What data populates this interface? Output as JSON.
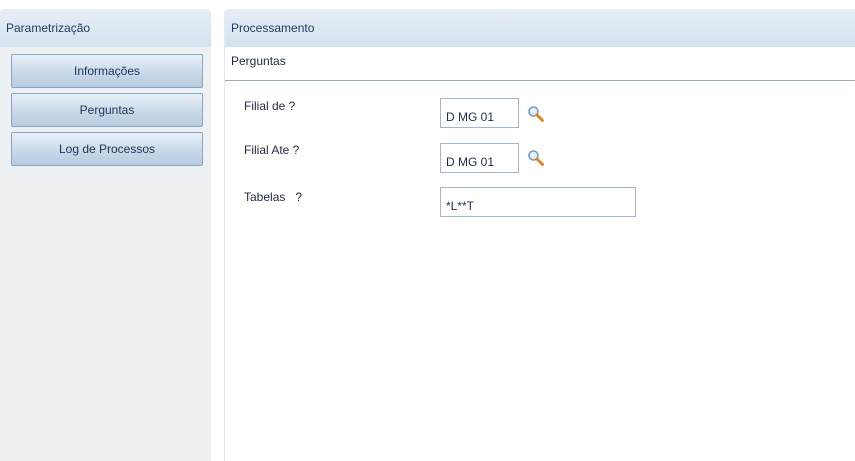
{
  "left_panel": {
    "header": "Parametrização",
    "nav": [
      {
        "label": "Informações"
      },
      {
        "label": "Perguntas"
      },
      {
        "label": "Log de Processos"
      }
    ]
  },
  "right_panel": {
    "header": "Processamento",
    "section_title": "Perguntas",
    "fields": [
      {
        "label": "Filial de ?",
        "value": "D MG 01",
        "icon": "search-icon"
      },
      {
        "label": "Filial Ate ?",
        "value": "D MG 01",
        "icon": "search-icon"
      },
      {
        "label": "Tabelas   ?",
        "value": "*L**T"
      }
    ]
  }
}
